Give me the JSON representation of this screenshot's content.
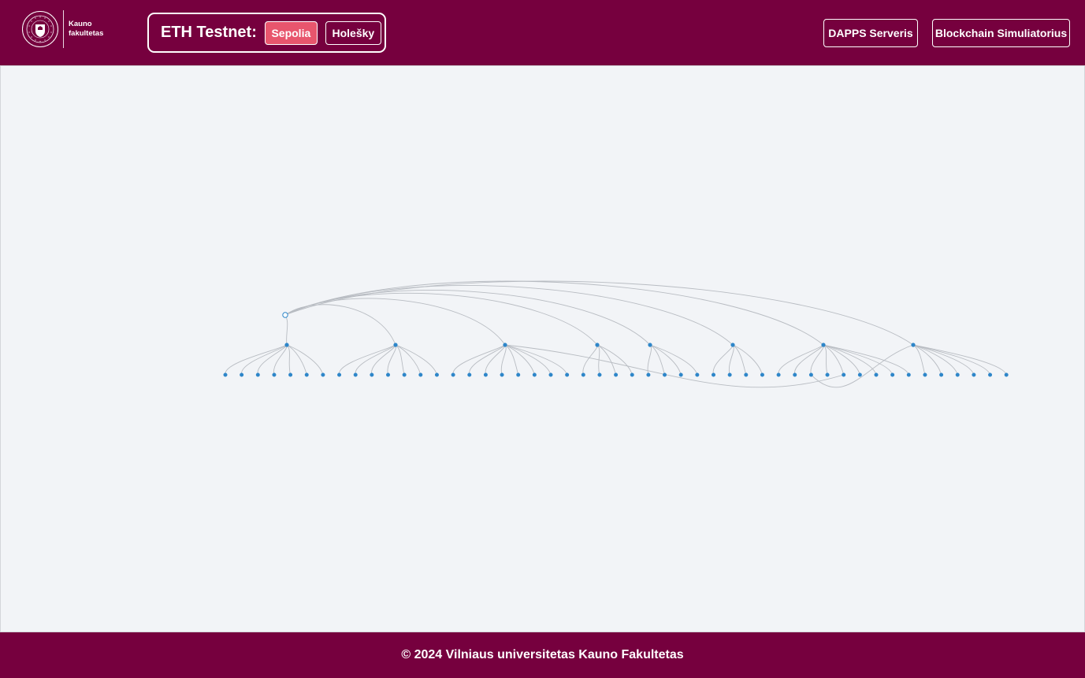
{
  "header": {
    "logo": {
      "line1": "Kauno",
      "line2": "fakultetas",
      "seal_lettering": "VILNIAUS UNIVERSITETAS · UNIVERSITAS VILNENSIS · 1579"
    },
    "testnet": {
      "label": "ETH Testnet:",
      "options": [
        {
          "label": "Sepolia",
          "active": true
        },
        {
          "label": "Holešky",
          "active": false
        }
      ]
    },
    "nav": {
      "dapps": "DAPPS Serveris",
      "simulator": "Blockchain Simuliatorius"
    }
  },
  "graph": {
    "root_icon": "contract-node-icon",
    "groups": [
      {
        "children": 7
      },
      {
        "children": 7
      },
      {
        "children": 8
      },
      {
        "children": 4
      },
      {
        "children": 4
      },
      {
        "children": 4
      },
      {
        "children": 9
      },
      {
        "children": 6
      }
    ],
    "cross_links": [
      {
        "from_group": 7,
        "to_leaf": 36
      },
      {
        "from_group": 2,
        "to_leaf": 38
      }
    ]
  },
  "colors": {
    "brand": "#76003e",
    "active_network": "#e8556d",
    "node": "#2e86c9",
    "edge": "#b8bcc2",
    "canvas_bg": "#f2f4f7"
  },
  "footer": {
    "text": "© 2024 Vilniaus universitetas Kauno Fakultetas"
  }
}
